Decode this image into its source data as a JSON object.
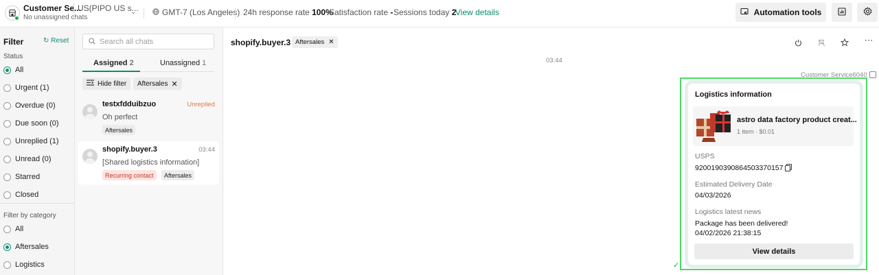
{
  "header": {
    "store_name": "Customer Se...",
    "store_region": "US(PIPO US s...",
    "store_status": "No unassigned chats",
    "timezone": "GMT-7 (Los Angeles)",
    "response_rate_label": "24h response rate",
    "response_rate_value": "100%",
    "satisfaction_label": "Satisfaction rate",
    "satisfaction_value": "-",
    "sessions_label": "Sessions today",
    "sessions_value": "2",
    "view_details": "View details",
    "automation_tools": "Automation tools",
    "status_color": "#1aaa55",
    "accent_color": "#0d8c6f"
  },
  "filter": {
    "title": "Filter",
    "reset": "Reset",
    "status_label": "Status",
    "status_options": [
      {
        "label": "All",
        "selected": true
      },
      {
        "label": "Urgent (1)",
        "selected": false
      },
      {
        "label": "Overdue (0)",
        "selected": false
      },
      {
        "label": "Due soon (0)",
        "selected": false
      },
      {
        "label": "Unreplied (1)",
        "selected": false
      },
      {
        "label": "Unread (0)",
        "selected": false
      },
      {
        "label": "Starred",
        "selected": false
      },
      {
        "label": "Closed",
        "selected": false
      }
    ],
    "category_label": "Filter by category",
    "category_options": [
      {
        "label": "All",
        "selected": false
      },
      {
        "label": "Aftersales",
        "selected": true
      },
      {
        "label": "Logistics",
        "selected": false
      }
    ]
  },
  "chatlist": {
    "search_placeholder": "Search all chats",
    "tabs": [
      {
        "label": "Assigned",
        "count": "2",
        "active": true
      },
      {
        "label": "Unassigned",
        "count": "1",
        "active": false
      }
    ],
    "hide_filter": "Hide filter",
    "active_filter": "Aftersales",
    "chats": [
      {
        "name": "testxfdduibzuo",
        "time": "Unreplied",
        "message": "Oh perfect",
        "tags": [
          "Aftersales"
        ]
      },
      {
        "name": "shopify.buyer.3",
        "time": "03:44",
        "message": "[Shared logistics information]",
        "tags": [
          "Recurring contact",
          "Aftersales"
        ]
      }
    ]
  },
  "conversation": {
    "buyer": "shopify.buyer.3",
    "tag": "Aftersales",
    "timestamp": "03:44",
    "agent": "Customer Service6040",
    "card": {
      "title": "Logistics information",
      "product_name": "astro data factory product creat...",
      "product_meta": "1 item · $0.01",
      "carrier": "USPS",
      "tracking_number": "9200190390864503370157",
      "delivery_label": "Estimated Delivery Date",
      "delivery_date": "04/03/2026",
      "news_label": "Logistics latest news",
      "news_text": "Package has been delivered!",
      "news_time": "04/02/2026 21:38:15",
      "button": "View details"
    }
  }
}
